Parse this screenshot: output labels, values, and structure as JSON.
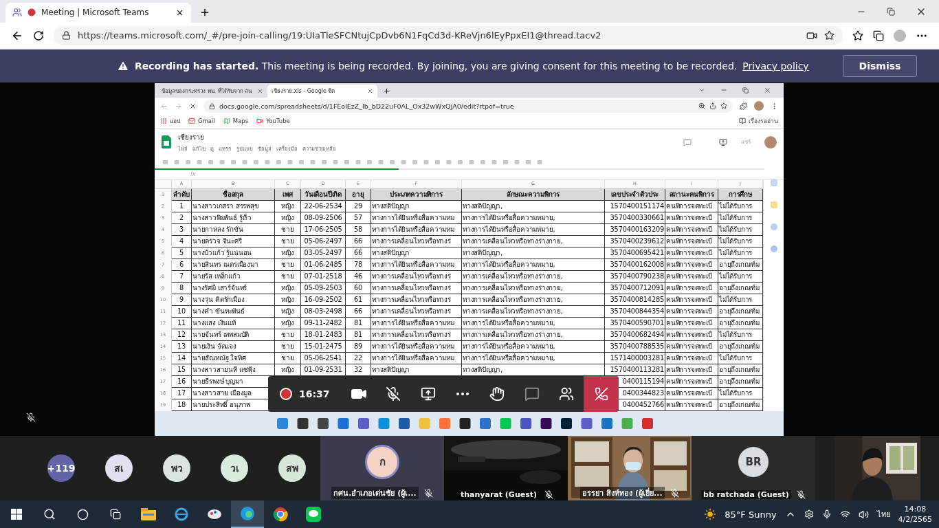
{
  "browser": {
    "tabs": [
      {
        "title": "Meeting | Microsoft Teams",
        "selected": true
      }
    ],
    "url": "https://teams.microsoft.com/_#/pre-join-calling/19:UIaTleSFCNtujCpDvb6N1FqCd3d-KReVjn6lEyPpxEI1@thread.tacv2"
  },
  "banner": {
    "text": "**Recording has started.** This meeting is being recorded. By joining, you are giving consent for this meeting to be recorded.",
    "link": "Privacy policy",
    "button": "Dismiss"
  },
  "shared_screen": {
    "tabs": [
      {
        "title": "ข้อมูลของกระทรวง พม. ที่ได้รับจาก สน",
        "selected": false
      },
      {
        "title": "เชียงราย.xls - Google ชีต",
        "selected": true
      }
    ],
    "url": "docs.google.com/spreadsheets/d/1FEolEzZ_Ib_bD22uF0AL_Ox32wWxQjA0/edit?rtpof=true",
    "bookmarks": [
      "แอป",
      "Gmail",
      "Maps",
      "YouTube"
    ],
    "reading_list": "เรื่องรออ่าน",
    "sheet": {
      "title": "เชียงราย",
      "menu": [
        "ไฟล์",
        "แก้ไข",
        "ดู",
        "แทรก",
        "รูปแบบ",
        "ข้อมูล",
        "เครื่องมือ",
        "ความช่วยเหลือ"
      ],
      "share": "แชร์",
      "progress": {
        "level": 0.4
      },
      "formula_label": "fx",
      "columns": [
        "A",
        "B",
        "C",
        "D",
        "E",
        "F",
        "G",
        "H",
        "I",
        "J"
      ],
      "row_numbers": [
        "1",
        "2",
        "3",
        "4",
        "5",
        "6",
        "7",
        "8",
        "9",
        "10",
        "11",
        "12",
        "13",
        "14",
        "15",
        "16",
        "17",
        "18",
        "19"
      ],
      "header": {
        "number": "ลำดับ",
        "name": "ชื่อสกุล",
        "gender": "เพศ",
        "birth_date": "วันเดือนปีเกิด",
        "age": "อายุ",
        "type": "ประเภทความพิการ",
        "description": "ลักษณะความพิการ",
        "id": "เลขประจำตัวประ",
        "status": "สถานะคนพิการ",
        "education": "การศึกษ"
      },
      "rows": [
        {
          "number": "1",
          "name": "นางสาวเกสรา สรรพสุข",
          "gender": "หญิง",
          "birth_date": "22-06-2534",
          "age": "29",
          "type": "ทางสติปัญญา",
          "description": "ทางสติปัญญา,",
          "id": "1570400151174",
          "status": "คนพิการจดทะเบี",
          "education": "ไม่ได้รับการ"
        },
        {
          "number": "2",
          "name": "นางสาวพิมพันธ์ รู้เร็ว",
          "gender": "หญิง",
          "birth_date": "08-09-2506",
          "age": "57",
          "type": "ทางการได้ยินหรือสื่อความหม",
          "description": "ทางการได้ยินหรือสื่อความหมาย,",
          "id": "3570400330661",
          "status": "คนพิการจดทะเบี",
          "education": "ไม่ได้รับการ"
        },
        {
          "number": "3",
          "name": "นายกาหลง รักขัน",
          "gender": "ชาย",
          "birth_date": "17-06-2505",
          "age": "58",
          "type": "ทางการได้ยินหรือสื่อความหม",
          "description": "ทางการได้ยินหรือสื่อความหมาย,",
          "id": "3570400163209",
          "status": "คนพิการจดทะเบี",
          "education": "ไม่ได้รับการ"
        },
        {
          "number": "4",
          "name": "นายตรวจ จินะศรี",
          "gender": "ชาย",
          "birth_date": "05-06-2497",
          "age": "66",
          "type": "ทางการเคลื่อนไหวหรือทางร่",
          "description": "ทางการเคลื่อนไหวหรือทางร่างกาย,",
          "id": "3570400239612",
          "status": "คนพิการจดทะเบี",
          "education": "ไม่ได้รับการ"
        },
        {
          "number": "5",
          "name": "นางบัวแก้ว รู้แน่นอน",
          "gender": "หญิง",
          "birth_date": "03-05-2497",
          "age": "66",
          "type": "ทางสติปัญญา",
          "description": "ทางสติปัญญา,",
          "id": "3570400695421",
          "status": "คนพิการจดทะเบี",
          "education": "ไม่ได้รับการ"
        },
        {
          "number": "6",
          "name": "นายสินทร เนตรเมืองมา",
          "gender": "ชาย",
          "birth_date": "01-06-2485",
          "age": "78",
          "type": "ทางการได้ยินหรือสื่อความหม",
          "description": "ทางการได้ยินหรือสื่อความหมาย,",
          "id": "3570400162008",
          "status": "คนพิการจดทะเบี",
          "education": "อายุถึงเกณฑ์ม"
        },
        {
          "number": "7",
          "name": "นายรัส เหล็กแก้ว",
          "gender": "ชาย",
          "birth_date": "07-01-2518",
          "age": "46",
          "type": "ทางการเคลื่อนไหวหรือทางร่",
          "description": "ทางการเคลื่อนไหวหรือทางร่างกาย,",
          "id": "3570400790238",
          "status": "คนพิการจดทะเบี",
          "education": "ไม่ได้รับการ"
        },
        {
          "number": "8",
          "name": "นางรัศมี เสาร์จันทร์",
          "gender": "หญิง",
          "birth_date": "05-09-2503",
          "age": "60",
          "type": "ทางการเคลื่อนไหวหรือทางร่",
          "description": "ทางการเคลื่อนไหวหรือทางร่างกาย,",
          "id": "3570400712091",
          "status": "คนพิการจดทะเบี",
          "education": "อายุถึงเกณฑ์ม"
        },
        {
          "number": "9",
          "name": "นางวุ่น คิดรักเมือง",
          "gender": "หญิง",
          "birth_date": "16-09-2502",
          "age": "61",
          "type": "ทางการเคลื่อนไหวหรือทางร่",
          "description": "ทางการเคลื่อนไหวหรือทางร่างกาย,",
          "id": "3570400814285",
          "status": "คนพิการจดทะเบี",
          "education": "ไม่ได้รับการ"
        },
        {
          "number": "10",
          "name": "นางคำ ขันทะพันธ์",
          "gender": "หญิง",
          "birth_date": "08-03-2498",
          "age": "66",
          "type": "ทางการเคลื่อนไหวหรือทางร่",
          "description": "ทางการเคลื่อนไหวหรือทางร่างกาย,",
          "id": "3570400844354",
          "status": "คนพิการจดทะเบี",
          "education": "อายุถึงเกณฑ์ม"
        },
        {
          "number": "11",
          "name": "นางแสง เงินแท้",
          "gender": "หญิง",
          "birth_date": "09-11-2482",
          "age": "81",
          "type": "ทางการได้ยินหรือสื่อความหม",
          "description": "ทางการได้ยินหรือสื่อความหมาย,",
          "id": "3570400590701",
          "status": "คนพิการจดทะเบี",
          "education": "อายุถึงเกณฑ์ม"
        },
        {
          "number": "12",
          "name": "นายจันทร์ เทพสมบัติ",
          "gender": "ชาย",
          "birth_date": "18-01-2483",
          "age": "81",
          "type": "ทางการเคลื่อนไหวหรือทางร่",
          "description": "ทางการเคลื่อนไหวหรือทางร่างกาย,",
          "id": "3570400682494",
          "status": "คนพิการจดทะเบี",
          "education": "ไม่ได้รับการ"
        },
        {
          "number": "13",
          "name": "นายเงิน จัดแจง",
          "gender": "ชาย",
          "birth_date": "15-01-2475",
          "age": "89",
          "type": "ทางการได้ยินหรือสื่อความหม",
          "description": "ทางการได้ยินหรือสื่อความหมาย,",
          "id": "3570400788535",
          "status": "คนพิการจดทะเบี",
          "education": "อายุถึงเกณฑ์ม"
        },
        {
          "number": "14",
          "name": "นายสัณหณัฐ ใจทิศ",
          "gender": "ชาย",
          "birth_date": "05-06-2541",
          "age": "22",
          "type": "ทางการได้ยินหรือสื่อความหม",
          "description": "ทางการได้ยินหรือสื่อความหมาย,",
          "id": "1571400003281",
          "status": "คนพิการจดทะเบี",
          "education": "ไม่ได้รับการ"
        },
        {
          "number": "15",
          "name": "นางสาวสายนที แซ่ฟุ้ง",
          "gender": "หญิง",
          "birth_date": "01-09-2531",
          "age": "32",
          "type": "ทางสติปัญญา",
          "description": "ทางสติปัญญา,",
          "id": "1570400113281",
          "status": "คนพิการจดทะเบี",
          "education": "อายุถึงเกณฑ์ม"
        },
        {
          "number": "16",
          "name": "นายธีรพงษ์ บุญมา",
          "id": "0400115194",
          "status": "คนพิการจดทะเบี",
          "education": "อายุถึงเกณฑ์ม"
        },
        {
          "number": "17",
          "name": "นางสาวสาย เมืองมูล",
          "id": "0400344823",
          "status": "คนพิการจดทะเบี",
          "education": "ไม่ได้รับการ"
        },
        {
          "number": "18",
          "name": "นายประสิทธิ์ อนุภาพ",
          "id": "0400452766",
          "status": "คนพิการจดทะเบี",
          "education": "อายุถึงเกณฑ์ม"
        }
      ]
    }
  },
  "call_toolbar": {
    "recording": true,
    "timer": "16:37",
    "camera_on": true,
    "mic_muted": true
  },
  "participants": {
    "avatars": [
      {
        "initials": "+119",
        "color": "#6264a7"
      },
      {
        "initials": "สเ",
        "color": "#e3def0"
      },
      {
        "initials": "พว",
        "color": "#dbe3e3"
      },
      {
        "initials": "วเ",
        "color": "#d8ebdc"
      },
      {
        "initials": "สพ",
        "color": "#d6e6d8"
      }
    ],
    "tiles": [
      {
        "kind": "avatar",
        "initials": "ก",
        "name": "กศน.อำเภอเด่นชัย (ผู้เ...",
        "muted": true
      },
      {
        "kind": "video",
        "name": "thanyarat (Guest)",
        "muted": true
      },
      {
        "kind": "video",
        "name": "อรรยา สิงห์ทอง (ผู้เยี่ย...",
        "muted": true
      },
      {
        "kind": "avatar",
        "initials": "BR",
        "name": "bb ratchada (Guest)",
        "muted": true
      },
      {
        "kind": "self"
      }
    ]
  },
  "taskbar": {
    "weather": "85°F  Sunny",
    "language": "ไทย",
    "time": "14:08",
    "date": "4/2/2565"
  }
}
